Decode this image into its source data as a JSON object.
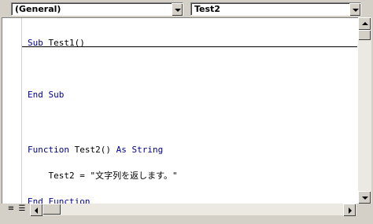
{
  "object_combo": {
    "value": "(General)",
    "icon": "chevron-down-icon"
  },
  "procedure_combo": {
    "value": "Test2",
    "icon": "chevron-down-icon"
  },
  "code": {
    "l1_kw": "Sub",
    "l1_rest": " Test1()",
    "l3_kw": "End Sub",
    "l5_kw1": "Function",
    "l5_rest": " Test2() ",
    "l5_kw2": "As String",
    "l6": "    Test2 = \"文字列を返します。\"",
    "l7_kw": "End Function"
  },
  "view_buttons": {
    "procedure_view": "≡",
    "full_module_view": "☰"
  }
}
